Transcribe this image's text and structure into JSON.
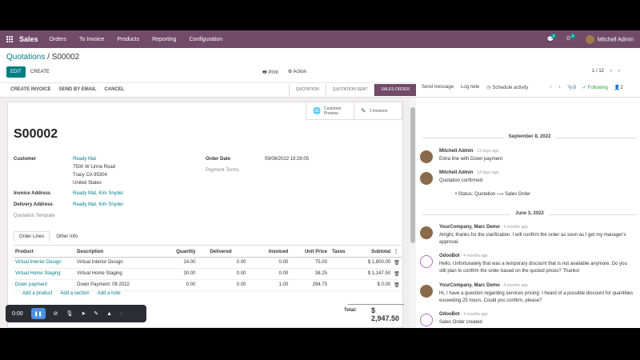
{
  "topbar": {
    "app": "Sales",
    "menu": [
      "Orders",
      "To Invoice",
      "Products",
      "Reporting",
      "Configuration"
    ],
    "chat_badge": "6",
    "activity_badge": "8",
    "user": "Mitchell Admin"
  },
  "breadcrumb": {
    "parent": "Quotations",
    "sep": " / ",
    "current": "S00002"
  },
  "buttons": {
    "edit": "EDIT",
    "create": "CREATE",
    "print": "Print",
    "action": "Action"
  },
  "pager": {
    "text": "1 / 12"
  },
  "statusbar": {
    "actions": [
      "CREATE INVOICE",
      "SEND BY EMAIL",
      "CANCEL"
    ],
    "steps": [
      "QUOTATION",
      "QUOTATION SENT",
      "SALES ORDER"
    ],
    "active_step": "SALES ORDER"
  },
  "chatter_top": {
    "send": "Send message",
    "log": "Log note",
    "schedule": "Schedule activity",
    "attachments": "0",
    "following": "Following",
    "followers": "2"
  },
  "smart": {
    "preview": "Customer Preview",
    "invoices": "1 Invoices"
  },
  "order": {
    "name": "S00002",
    "customer_label": "Customer",
    "customer": [
      "Ready Mat",
      "7500 W Linne Road",
      "Tracy CA 95304",
      "United States"
    ],
    "invoice_addr_label": "Invoice Address",
    "invoice_addr": "Ready Mat, Kim Snyder",
    "delivery_addr_label": "Delivery Address",
    "delivery_addr": "Ready Mat, Kim Snyder",
    "template_label": "Quotation Template",
    "order_date_label": "Order Date",
    "order_date": "09/08/2022 19:26:05",
    "payment_terms_label": "Payment Terms"
  },
  "tabs": [
    "Order Lines",
    "Other Info"
  ],
  "lines": {
    "headers": [
      "Product",
      "Description",
      "Quantity",
      "Delivered",
      "Invoiced",
      "Unit Price",
      "Taxes",
      "Subtotal"
    ],
    "rows": [
      [
        "Virtual Interior Design",
        "Virtual Interior Design",
        "24.00",
        "0.00",
        "0.00",
        "75.00",
        "",
        "$ 1,800.00"
      ],
      [
        "Virtual Home Staging",
        "Virtual Home Staging",
        "30.00",
        "0.00",
        "0.00",
        "38.25",
        "",
        "$ 1,147.50"
      ],
      [
        "Down payment",
        "Down Payment: 09 2022",
        "0.00",
        "0.00",
        "1.00",
        "294.75",
        "",
        "$ 0.00"
      ]
    ],
    "add": [
      "Add a product",
      "Add a section",
      "Add a note"
    ],
    "total_label": "Total:",
    "total": "$ 2,947.50"
  },
  "chatter": {
    "day1": "September 8, 2022",
    "day2": "June 3, 2022",
    "messages": [
      {
        "author": "Mitchell Admin",
        "when": "- 13 days ago",
        "body": "Extra line with Down payment"
      },
      {
        "author": "Mitchell Admin",
        "when": "- 13 days ago",
        "body": "Quotation confirmed",
        "bullet": "Status: Quotation ⟶ Sales Order"
      },
      {
        "author": "YourCompany, Marc Demo",
        "when": "- 4 months ago",
        "body": "Alright, thanks for the clarification. I will confirm the order as soon as I get my manager's approval."
      },
      {
        "author": "OdooBot",
        "when": "- 4 months ago",
        "body": "Hello, Unfortunately that was a temporary discount that is not available anymore. Do you still plan to confirm the order based on the quoted prices? Thanks!"
      },
      {
        "author": "YourCompany, Marc Demo",
        "when": "- 4 months ago",
        "body": "Hi, I have a question regarding services pricing: I heard of a possible discount for quantities exceeding 25 hours. Could you confirm, please?"
      },
      {
        "author": "OdooBot",
        "when": "- 4 months ago",
        "body": "Sales Order created"
      }
    ]
  },
  "recorder": {
    "time": "0:00"
  }
}
